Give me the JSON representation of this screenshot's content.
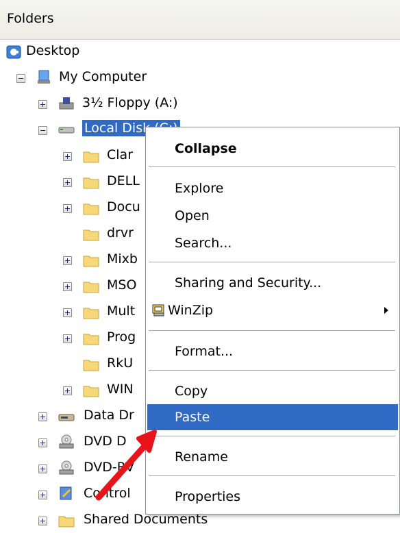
{
  "panel": {
    "title": "Folders"
  },
  "tree": {
    "desktop": "Desktop",
    "my_computer": "My Computer",
    "floppy": "3½ Floppy (A:)",
    "local_disk": "Local Disk (C:)",
    "folders": [
      "Clar",
      "DELL",
      "Docu",
      "drvr",
      "Mixb",
      "MSO",
      "Mult",
      "Prog",
      "RkU",
      "WIN"
    ],
    "data_drive": "Data Dr",
    "dvd1": "DVD D",
    "dvd2": "DVD-RV",
    "control": "Control",
    "shared": "Shared Documents"
  },
  "menu": {
    "items": [
      {
        "label": "Collapse"
      },
      {
        "label": "Explore"
      },
      {
        "label": "Open"
      },
      {
        "label": "Search..."
      },
      {
        "label": "Sharing and Security..."
      },
      {
        "label": "WinZip"
      },
      {
        "label": "Format..."
      },
      {
        "label": "Copy"
      },
      {
        "label": "Paste"
      },
      {
        "label": "Rename"
      },
      {
        "label": "Properties"
      }
    ],
    "highlighted": "Paste"
  },
  "colors": {
    "selection": "#316ac5",
    "arrow": "#e8141c"
  }
}
